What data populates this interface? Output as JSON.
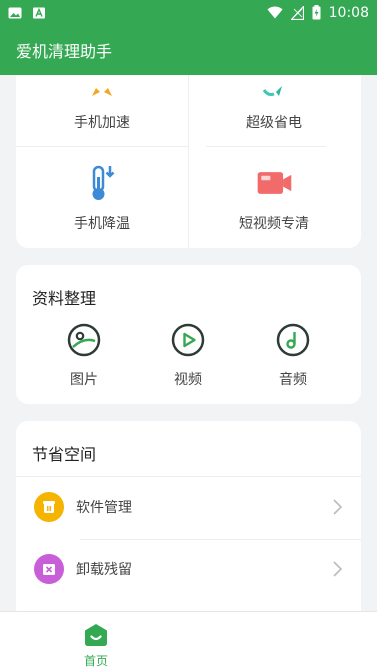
{
  "status_bar": {
    "time": "10:08"
  },
  "app_bar": {
    "title": "爱机清理助手"
  },
  "tools": {
    "items": [
      {
        "label": "手机加速",
        "icon": "rocket-icon"
      },
      {
        "label": "超级省电",
        "icon": "battery-saver-icon"
      },
      {
        "label": "手机降温",
        "icon": "thermometer-icon"
      },
      {
        "label": "短视频专清",
        "icon": "video-camera-icon"
      }
    ]
  },
  "files": {
    "title": "资料整理",
    "items": [
      {
        "label": "图片",
        "icon": "image-icon"
      },
      {
        "label": "视频",
        "icon": "play-icon"
      },
      {
        "label": "音频",
        "icon": "music-icon"
      }
    ]
  },
  "space": {
    "title": "节省空间",
    "rows": [
      {
        "label": "软件管理",
        "icon": "app-manager-icon",
        "color": "#f5b400"
      },
      {
        "label": "卸载残留",
        "icon": "uninstall-residue-icon",
        "color": "#c85ed8"
      }
    ]
  },
  "bottom_nav": {
    "home_label": "首页"
  },
  "colors": {
    "accent": "#34a853"
  }
}
